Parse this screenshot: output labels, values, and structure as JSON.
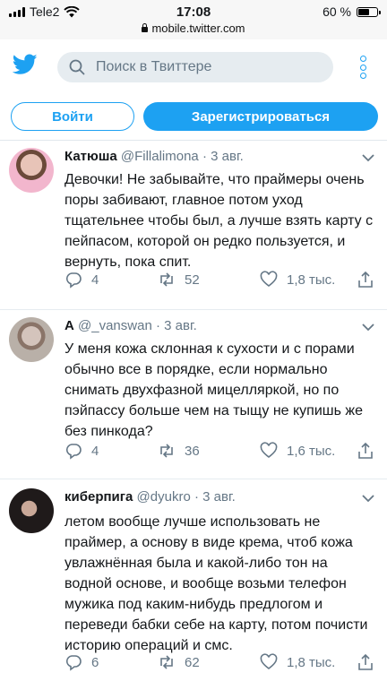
{
  "status_bar": {
    "carrier": "Tele2",
    "time": "17:08",
    "battery_pct": "60 %",
    "battery_level": 0.6,
    "url": "mobile.twitter.com"
  },
  "header": {
    "search_placeholder": "Поиск в Твиттере"
  },
  "auth": {
    "login_label": "Войти",
    "signup_label": "Зарегистрироваться"
  },
  "colors": {
    "accent": "#1da1f2",
    "text": "#14171a",
    "muted": "#657786"
  },
  "tweets": [
    {
      "name": "Катюша",
      "handle": "@Fillalimona",
      "dot": "·",
      "time": "3 авг.",
      "text": "Девочки! Не забывайте, что праймеры очень поры забивают, главное потом уход тщательнее чтобы был, а лучше взять карту с пейпасом, которой он редко пользуется, и вернуть, пока спит.",
      "replies": "4",
      "retweets": "52",
      "likes": "1,8 тыс."
    },
    {
      "name": "A",
      "handle": "@_vanswan",
      "dot": "·",
      "time": "3 авг.",
      "text": "У меня кожа склонная к сухости и с порами обычно все в порядке, если нормально снимать двухфазной мицелляркой, но по пэйпассу больше чем на тыщу не купишь же без пинкода?",
      "replies": "4",
      "retweets": "36",
      "likes": "1,6 тыс."
    },
    {
      "name": "киберпига",
      "handle": "@dyukro",
      "dot": "·",
      "time": "3 авг.",
      "text": "летом вообще лучше использовать не праймер, а основу в виде крема, чтоб кожа увлажнённая была и какой-либо тон на водной основе, и вообще возьми телефон мужика под каким-нибудь предлогом и переведи бабки себе на карту, потом почисти историю операций и смс.",
      "replies": "6",
      "retweets": "62",
      "likes": "1,8 тыс."
    }
  ]
}
